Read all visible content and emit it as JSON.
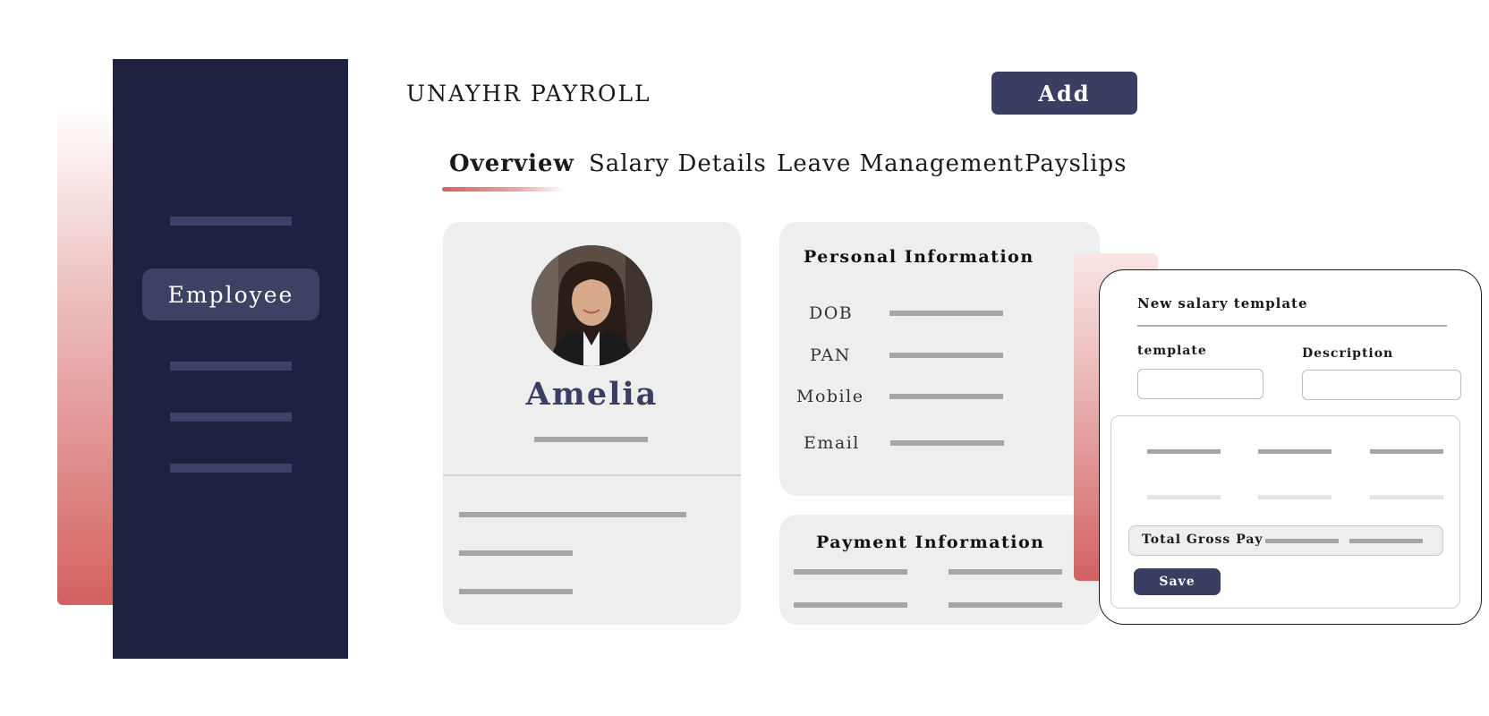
{
  "app": {
    "title": "UNAYHR PAYROLL"
  },
  "sidebar": {
    "active_item": "Employee"
  },
  "header": {
    "add_label": "Add"
  },
  "tabs": [
    {
      "label": "Overview",
      "active": true
    },
    {
      "label": "Salary Details",
      "active": false
    },
    {
      "label": "Leave Management",
      "active": false
    },
    {
      "label": "Payslips",
      "active": false
    }
  ],
  "profile": {
    "name": "Amelia",
    "avatar": "employee-photo"
  },
  "personal_info": {
    "title": "Personal Information",
    "fields": [
      "DOB",
      "PAN",
      "Mobile",
      "Email"
    ]
  },
  "payment_info": {
    "title": "Payment Information"
  },
  "salary_modal": {
    "title": "New salary template",
    "template_label": "template",
    "description_label": "Description",
    "gross_label": "Total Gross Pay",
    "save_label": "Save"
  },
  "colors": {
    "sidebar_bg": "#1e2140",
    "accent_navy": "#3b3e63",
    "accent_red": "#d46161",
    "card_bg": "#eeeeee"
  }
}
